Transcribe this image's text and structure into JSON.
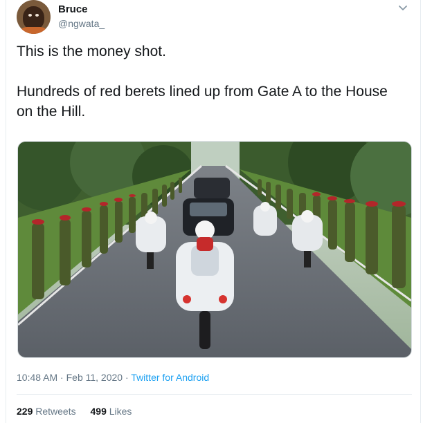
{
  "user": {
    "name": "Bruce",
    "handle": "@ngwata_"
  },
  "tweet": {
    "paragraphs": [
      "This is the money shot.",
      "Hundreds of red berets lined up from Gate A to the House on the Hill."
    ],
    "image_description_alt": "Motorcade of white police motorcycles and black cars driving between two lines of soldiers in red berets"
  },
  "meta": {
    "time": "10:48 AM",
    "separator1": " · ",
    "date": "Feb 11, 2020",
    "separator2": " · ",
    "source": "Twitter for Android"
  },
  "stats": {
    "retweets_count": "229",
    "retweets_label": "Retweets",
    "likes_count": "499",
    "likes_label": "Likes"
  },
  "icons": {
    "menu": "chevron-down-icon"
  },
  "colors": {
    "link": "#1da1f2",
    "secondary_text": "#657786",
    "primary_text": "#14171a"
  }
}
